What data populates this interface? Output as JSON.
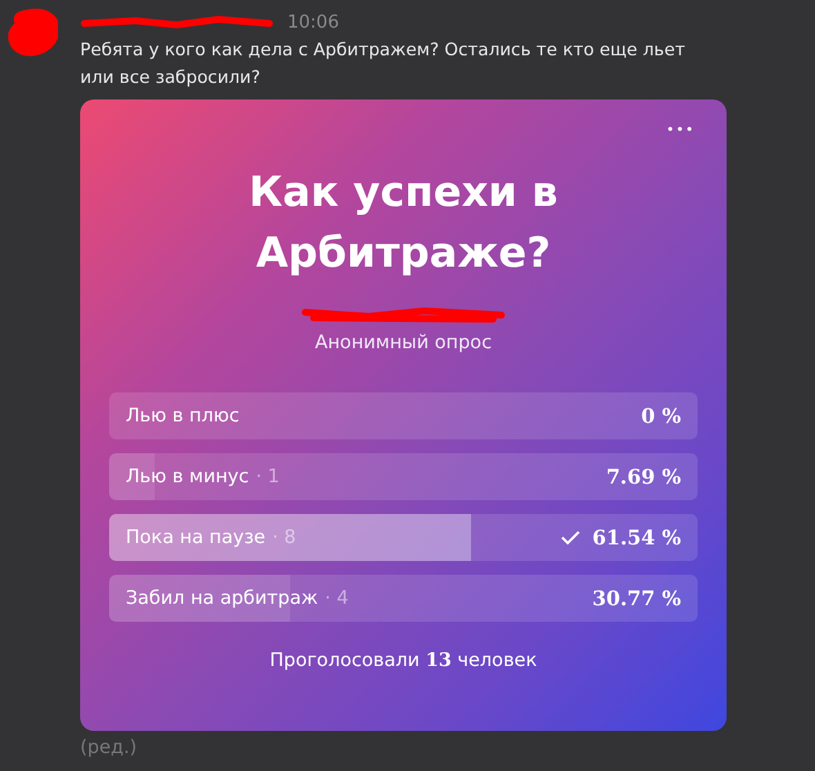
{
  "message": {
    "author": {
      "redacted": true
    },
    "avatar": {
      "redacted": true
    },
    "time": "10:06",
    "text": "Ребята у кого как дела с Арбитражем? Остались те кто еще льет или все забросили?",
    "edited_note": "(ред.)"
  },
  "poll": {
    "menu_icon": "•••",
    "title": "Как успехи в Арбитраже?",
    "source": {
      "redacted": true
    },
    "kind_label": "Анонимный опрос",
    "options": [
      {
        "label": "Лью в плюс",
        "percent": "0 %",
        "selected": false
      },
      {
        "label": "Лью в минус",
        "count": "· 1",
        "percent": "7.69 %",
        "level": 0.0769,
        "selected": false
      },
      {
        "label": "Пока на паузе",
        "count": "· 8",
        "percent": "61.54 %",
        "level": 0.6154,
        "selected": true
      },
      {
        "label": "Забил на арбитраж",
        "count": "· 4",
        "percent": "30.77 %",
        "level": 0.3077,
        "selected": false
      }
    ],
    "total": "Проголосовали **13** человек"
  }
}
